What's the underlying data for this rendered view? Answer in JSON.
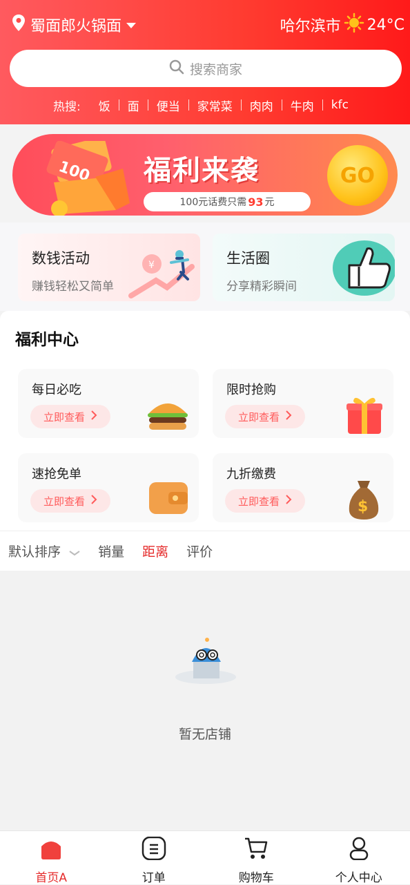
{
  "header": {
    "location": "蜀面郎火锅面",
    "city": "哈尔滨市",
    "temperature": "24°C",
    "search_placeholder": "搜索商家",
    "hot_label": "热搜:",
    "hot_items": [
      "饭",
      "面",
      "便当",
      "家常菜",
      "肉肉",
      "牛肉",
      "kfc"
    ]
  },
  "banner": {
    "title": "福利来袭",
    "pill_prefix": "100元话费只需",
    "pill_highlight": "93",
    "pill_suffix": "元",
    "go_label": "GO",
    "gift_card_text": "100"
  },
  "promos": [
    {
      "title": "数钱活动",
      "subtitle": "赚钱轻松又简单"
    },
    {
      "title": "生活圈",
      "subtitle": "分享精彩瞬间"
    }
  ],
  "welfare": {
    "title": "福利中心",
    "cards": [
      {
        "title": "每日必吃",
        "button": "立即查看",
        "icon": "burger-icon"
      },
      {
        "title": "限时抢购",
        "button": "立即查看",
        "icon": "gift-box-icon"
      },
      {
        "title": "速抢免单",
        "button": "立即查看",
        "icon": "wallet-icon"
      },
      {
        "title": "九折缴费",
        "button": "立即查看",
        "icon": "money-bag-icon"
      }
    ]
  },
  "sort": {
    "default": "默认排序",
    "sales": "销量",
    "distance": "距离",
    "rating": "评价",
    "active": "distance"
  },
  "empty": {
    "text": "暂无店铺"
  },
  "tabbar": [
    {
      "label": "首页A",
      "icon": "home-icon",
      "active": true
    },
    {
      "label": "订单",
      "icon": "order-icon",
      "active": false
    },
    {
      "label": "购物车",
      "icon": "cart-icon",
      "active": false
    },
    {
      "label": "个人中心",
      "icon": "profile-icon",
      "active": false
    }
  ],
  "colors": {
    "accent": "#ff3b30",
    "active_text": "#e52b2b"
  }
}
